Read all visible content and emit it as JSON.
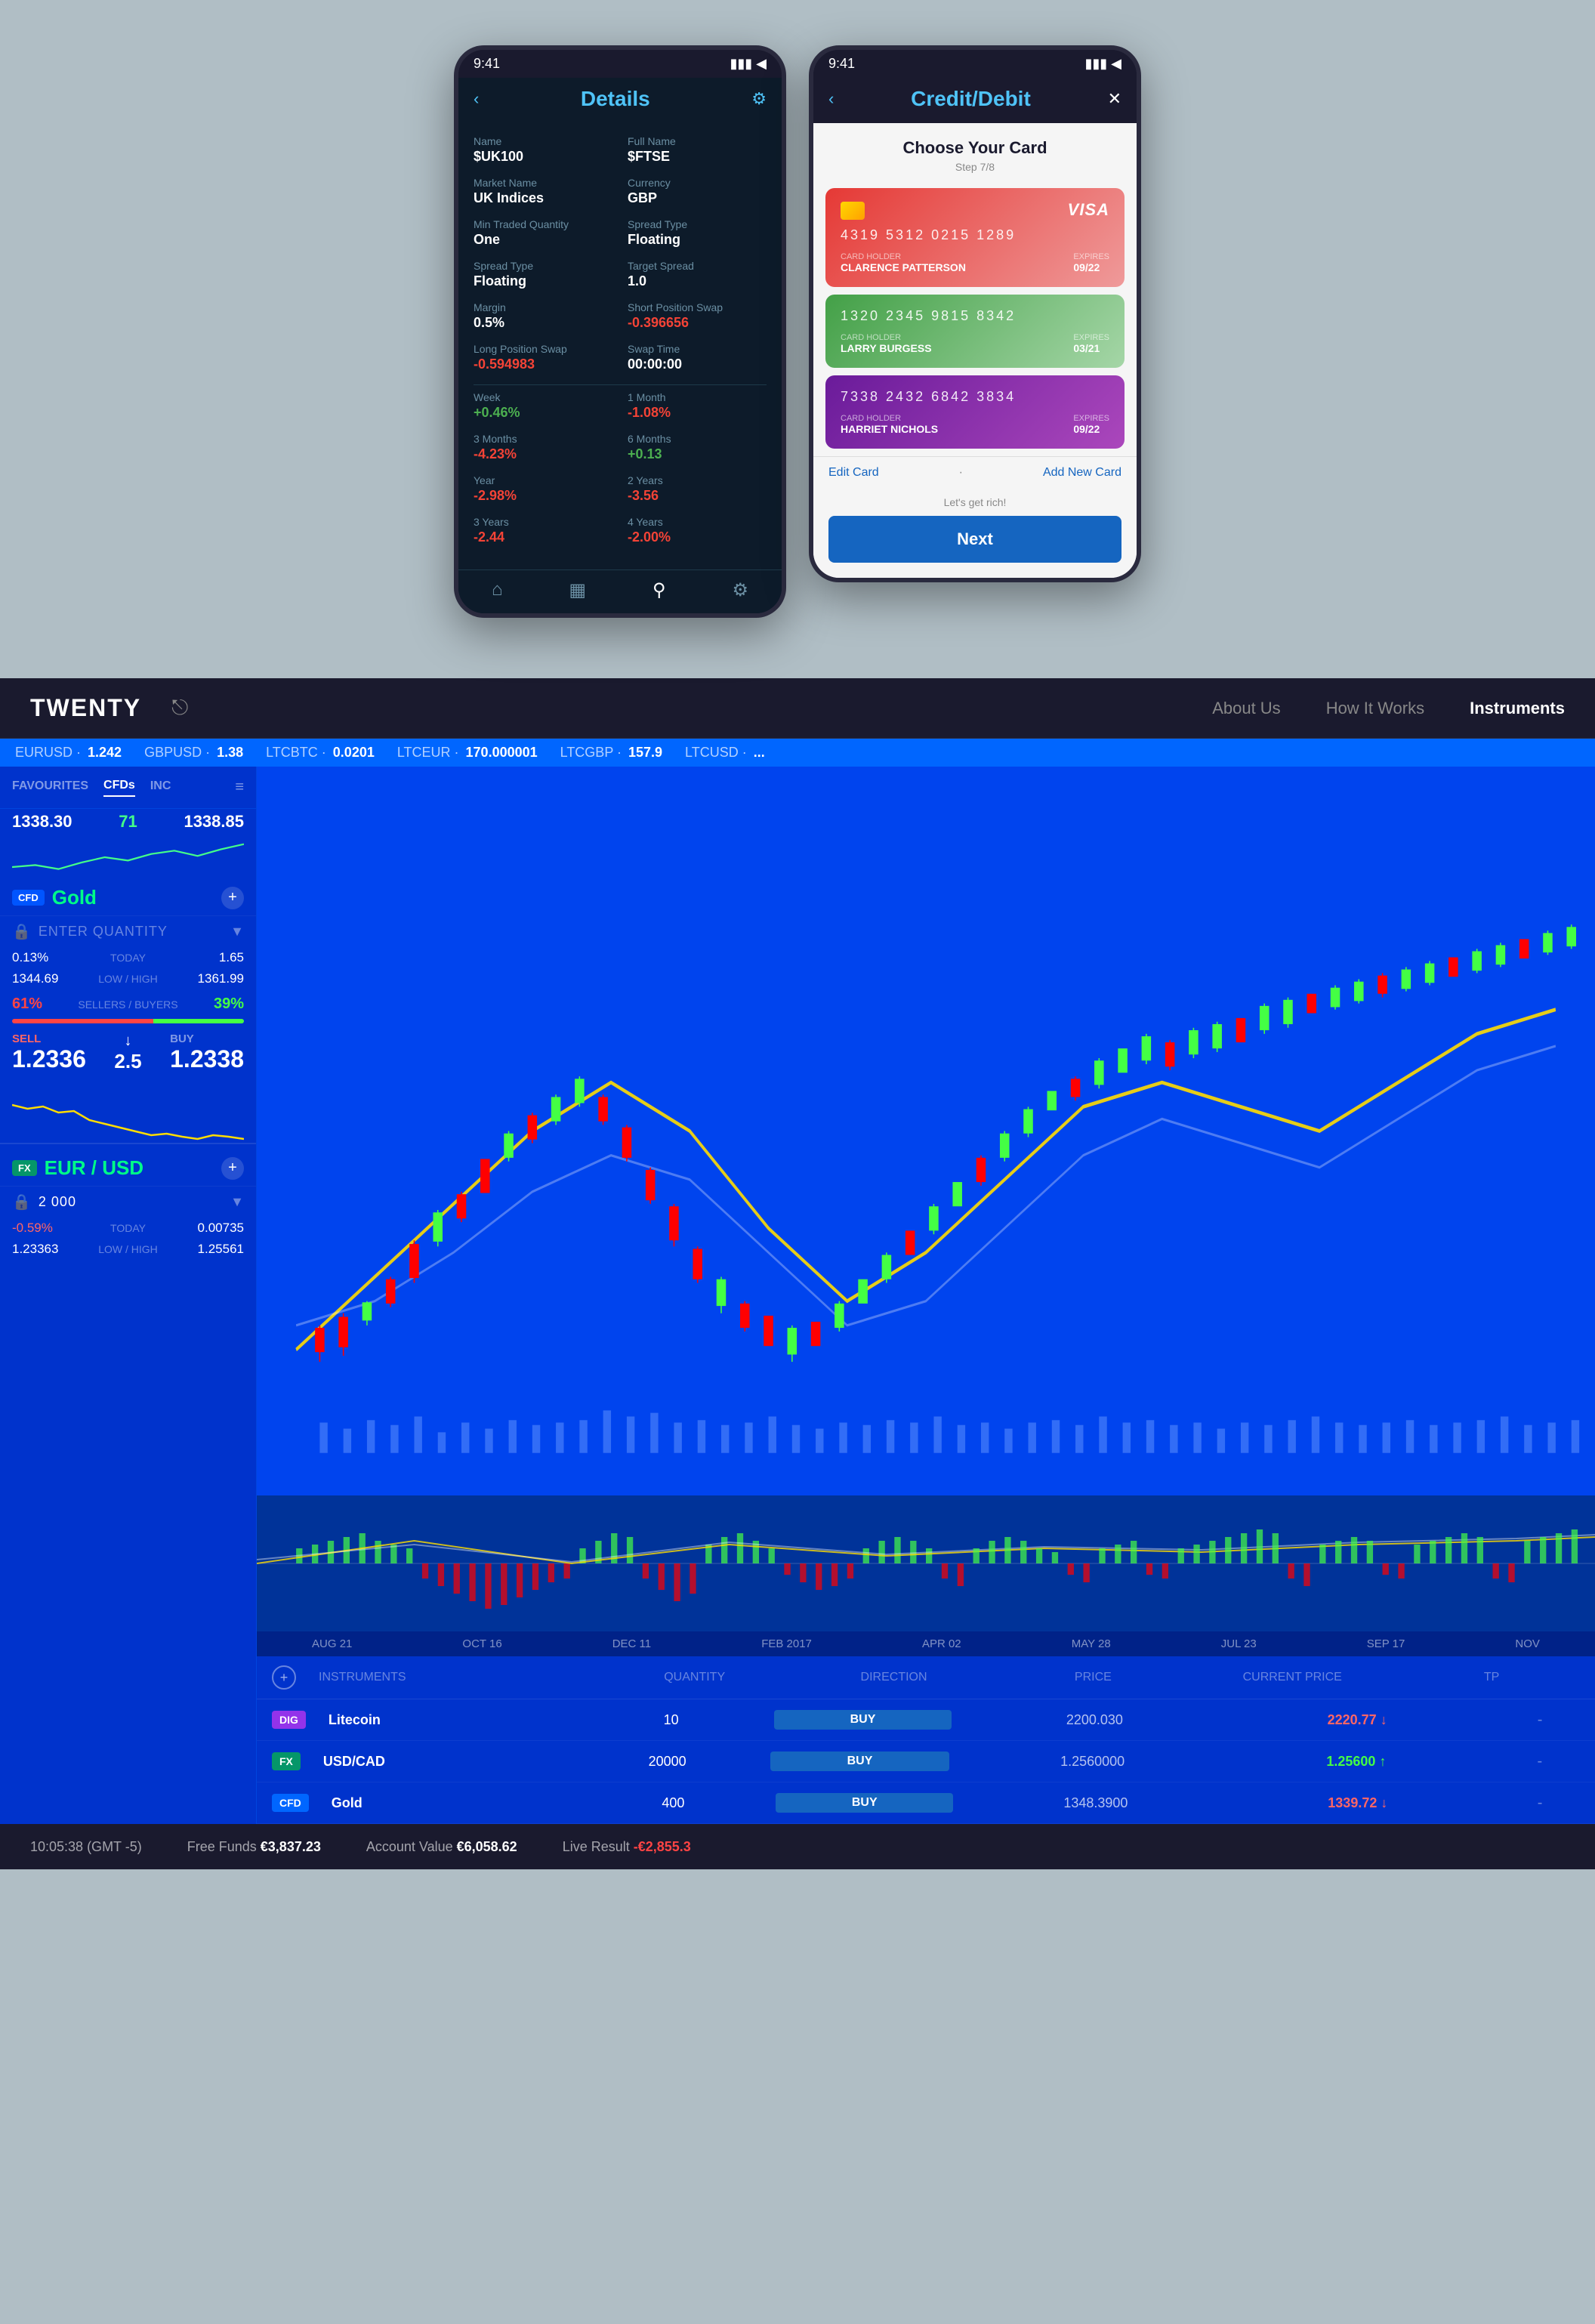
{
  "mobile": {
    "details": {
      "title": "Details",
      "name_label": "Name",
      "name_value": "$UK100",
      "full_name_label": "Full Name",
      "full_name_value": "$FTSE",
      "market_name_label": "Market Name",
      "market_name_value": "UK Indices",
      "currency_label": "Currency",
      "currency_value": "GBP",
      "min_traded_label": "Min Traded Quantity",
      "min_traded_value": "One",
      "spread_type_label": "Spread Type",
      "spread_type_value": "Floating",
      "spread_type2_label": "Spread Type",
      "spread_type2_value": "Floating",
      "target_spread_label": "Target Spread",
      "target_spread_value": "1.0",
      "margin_label": "Margin",
      "margin_value": "0.5%",
      "short_pos_swap_label": "Short Position Swap",
      "short_pos_swap_value": "-0.396656",
      "long_pos_swap_label": "Long Position Swap",
      "long_pos_swap_value": "-0.594983",
      "swap_time_label": "Swap Time",
      "swap_time_value": "00:00:00",
      "week_label": "Week",
      "week_value": "+0.46%",
      "one_month_label": "1 Month",
      "one_month_value": "-1.08%",
      "three_months_label": "3 Months",
      "three_months_value": "-4.23%",
      "six_months_label": "6 Months",
      "six_months_value": "+0.13",
      "year_label": "Year",
      "year_value": "-2.98%",
      "two_years_label": "2 Years",
      "two_years_value": "-3.56",
      "three_years_label": "3 Years",
      "three_years_value": "-2.44",
      "four_years_label": "4 Years",
      "four_years_value": "-2.00%"
    },
    "credit": {
      "title": "Credit/Debit",
      "choose_title": "Choose Your Card",
      "step_text": "Step 7/8",
      "cards": [
        {
          "number": "4319  5312  0215  1289",
          "holder_label": "CARD HOLDER",
          "holder": "CLARENCE PATTERSON",
          "expires_label": "EXPIRES",
          "expires": "09/22",
          "brand": "VISA",
          "color": "red"
        },
        {
          "number": "1320  2345  9815  8342",
          "holder_label": "CARD HOLDER",
          "holder": "LARRY BURGESS",
          "expires_label": "EXPIRES",
          "expires": "03/21",
          "brand": "",
          "color": "green"
        },
        {
          "number": "7338  2432  6842  3834",
          "holder_label": "CARD HOLDER",
          "holder": "HARRIET NICHOLS",
          "expires_label": "EXPIRES",
          "expires": "09/22",
          "brand": "",
          "color": "purple"
        }
      ],
      "edit_card": "Edit Card",
      "add_new_card": "Add New Card",
      "lets_get_rich": "Let's get rich!",
      "next_button": "Next"
    }
  },
  "platform": {
    "nav": {
      "logo": "TWENTY",
      "links": [
        "About Us",
        "How It Works",
        "Instruments"
      ],
      "active_link": "Instruments"
    },
    "ticker": [
      {
        "label": "EURUSD",
        "value": "1.242"
      },
      {
        "label": "GBPUSD",
        "value": "1.38"
      },
      {
        "label": "LTCBTC",
        "value": "0.0201"
      },
      {
        "label": "LTCEUR",
        "value": "170.000001"
      },
      {
        "label": "LTCGBP",
        "value": "157.9"
      },
      {
        "label": "LTCUSD",
        "value": "..."
      }
    ],
    "left_panel": {
      "tabs": [
        "FAVOURITES",
        "CFDs",
        "INC"
      ],
      "active_tab": "CFDs",
      "gold_instrument": {
        "numbers_left": "1338.30",
        "numbers_mid": "71",
        "numbers_right": "1338.85",
        "badge": "CFD",
        "name": "Gold",
        "quantity_placeholder": "ENTER QUANTITY",
        "change_pct": "0.13%",
        "today_label": "TODAY",
        "today_value": "1.65",
        "low": "1344.69",
        "low_high_label": "LOW / HIGH",
        "high": "1361.99",
        "sellers_pct": "61%",
        "sellers_buyers_label": "SELLERS / BUYERS",
        "buyers_pct": "39%",
        "sell_label": "SELL",
        "sell_price": "1.2336",
        "spread": "2.5",
        "buy_price": "1.2338",
        "buy_label": "BUY"
      },
      "eur_usd_instrument": {
        "badge": "FX",
        "name": "EUR / USD",
        "quantity_value": "2 000",
        "change_pct": "-0.59%",
        "today_label": "TODAY",
        "today_value": "0.00735",
        "low": "1.23363",
        "low_high_label": "LOW / HIGH",
        "high": "1.25561"
      }
    },
    "chart": {
      "time_labels": [
        "AUG 21",
        "OCT 16",
        "DEC 11",
        "FEB 2017",
        "APR 02",
        "MAY 28",
        "JUL 23",
        "SEP 17",
        "NOV"
      ]
    },
    "orders": {
      "col_headers": [
        "INSTRUMENTS",
        "QUANTITY",
        "DIRECTION",
        "PRICE",
        "CURRENT PRICE",
        "TP"
      ],
      "rows": [
        {
          "badge_type": "DIG",
          "badge_color": "dig",
          "instrument": "Litecoin",
          "quantity": "10",
          "direction": "BUY",
          "price": "2200.030",
          "current_price": "2220.77",
          "price_direction": "down",
          "tp": "-"
        },
        {
          "badge_type": "FX",
          "badge_color": "fx",
          "instrument": "USD/CAD",
          "quantity": "20000",
          "direction": "BUY",
          "price": "1.2560000",
          "current_price": "1.25600",
          "price_direction": "up",
          "tp": "-"
        },
        {
          "badge_type": "CFD",
          "badge_color": "cfd",
          "instrument": "Gold",
          "quantity": "400",
          "direction": "BUY",
          "price": "1348.3900",
          "current_price": "1339.72",
          "price_direction": "down",
          "tp": "-"
        }
      ]
    },
    "status_bar": {
      "time": "10:05:38 (GMT -5)",
      "free_funds_label": "Free Funds",
      "free_funds": "€3,837.23",
      "account_value_label": "Account Value",
      "account_value": "€6,058.62",
      "live_result_label": "Live Result",
      "live_result": "-€2,855.3"
    }
  }
}
